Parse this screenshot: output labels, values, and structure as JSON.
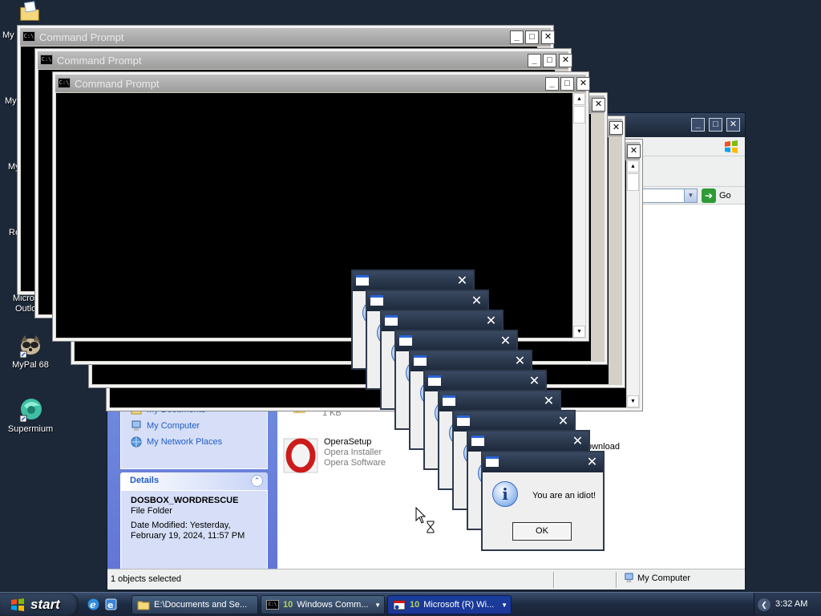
{
  "desktop": {
    "icons": [
      {
        "label": "My Documents",
        "icon": "folder-icon"
      },
      {
        "label": "My Computer",
        "icon": "computer-icon"
      },
      {
        "label": "My Network Places",
        "icon": "network-icon"
      },
      {
        "label": "Recycle Bin",
        "icon": "recycle-bin-icon"
      },
      {
        "label": "Microsoft Outlook",
        "icon": "outlook-icon"
      },
      {
        "label": "MyPal 68",
        "icon": "mypal-icon"
      },
      {
        "label": "Supermium",
        "icon": "supermium-icon"
      }
    ],
    "partial_labels": [
      "My I",
      "My",
      "My",
      "Re",
      "Micros",
      "Outlo"
    ]
  },
  "command_prompts": [
    {
      "title": "Command Prompt"
    },
    {
      "title": "Command Prompt"
    },
    {
      "title": "Command Prompt"
    }
  ],
  "explorer": {
    "address_go": "Go",
    "other_places": {
      "items": [
        {
          "label": "My Documents",
          "icon": "folder-icon"
        },
        {
          "label": "My Computer",
          "icon": "computer-icon"
        },
        {
          "label": "My Network Places",
          "icon": "network-icon"
        }
      ]
    },
    "details": {
      "title": "Details",
      "name": "DOSBOX_WORDRESCUE",
      "type": "File Folder",
      "modified": "Date Modified: Yesterday, February 19, 2024, 11:57 PM"
    },
    "files": [
      {
        "name": "",
        "sub1": "1 KB",
        "sub2": ""
      },
      {
        "name": "OperaSetup",
        "sub1": "Opera Installer",
        "sub2": "Opera Software"
      },
      {
        "name": "ownload",
        "sub1": "",
        "sub2": ""
      }
    ],
    "status_left": "1 objects selected",
    "status_right": "My Computer"
  },
  "message_box": {
    "text": "You are an idiot!",
    "ok": "OK",
    "stack_count": 9
  },
  "taskbar": {
    "start": "start",
    "buttons": [
      {
        "count": "",
        "label": "E:\\Documents and Se...",
        "icon": "folder-icon",
        "active": false
      },
      {
        "count": "10",
        "label": "Windows Comm...",
        "icon": "cmd-icon",
        "active": false
      },
      {
        "count": "10",
        "label": "Microsoft (R) Wi...",
        "icon": "script-icon",
        "active": true
      }
    ],
    "clock": "3:32 AM"
  },
  "colors": {
    "desktop_bg": "#1c2838",
    "taskbar_active": "#1b3696",
    "link_blue": "#215dc6"
  }
}
